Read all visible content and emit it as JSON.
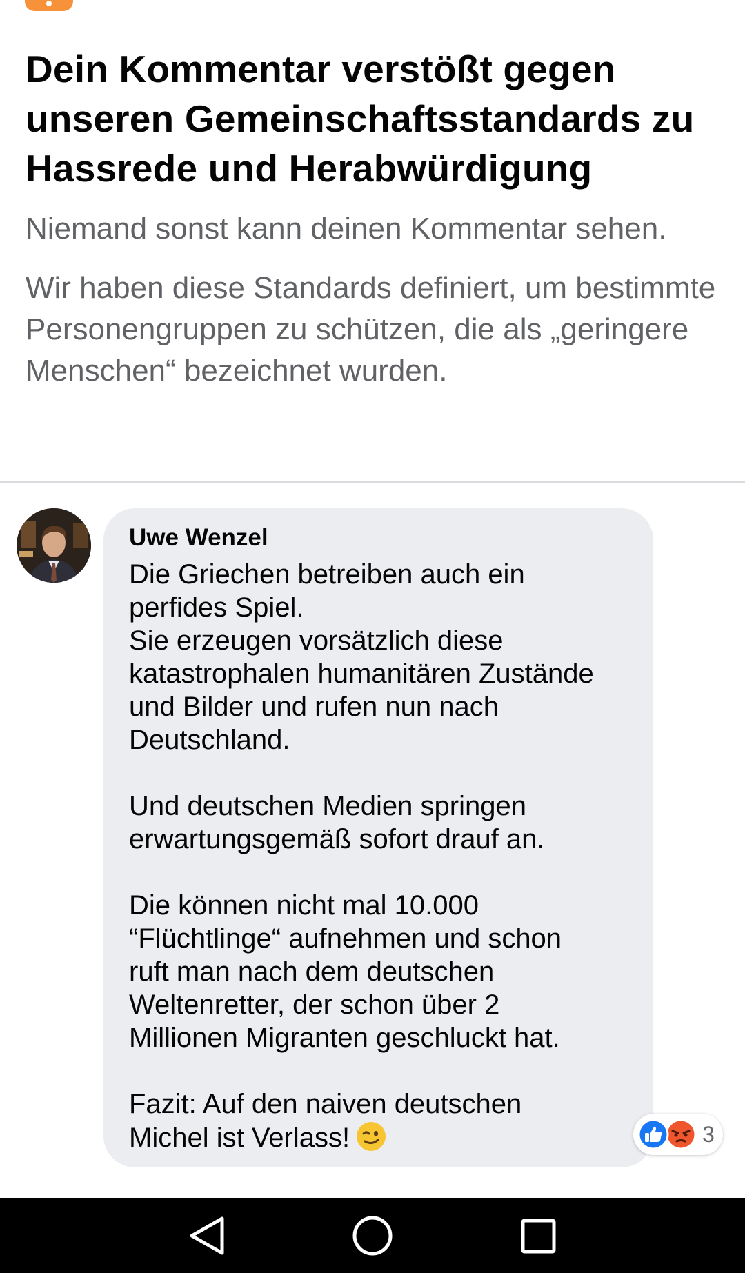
{
  "notice": {
    "title": "Dein Kommentar verstößt gegen unseren Gemeinschaftsstandards zu Hassrede und Herabwürdigung",
    "subtitle": "Niemand sonst kann deinen Kommentar sehen.",
    "body": "Wir haben diese Standards definiert, um bestimmte Personengruppen zu schützen, die als „geringere Menschen“ bezeichnet wurden.",
    "icon": "warning-icon",
    "accent_color": "#f7923a"
  },
  "comment": {
    "author": "Uwe Wenzel",
    "text": "Die Griechen betreiben auch ein\nperfides Spiel.\nSie erzeugen vorsätzlich diese\nkatastrophalen humanitären Zustände\nund Bilder und rufen nun nach\nDeutschland.\n\nUnd deutschen Medien springen\nerwartungsgemäß sofort drauf an.\n\nDie können nicht mal 10.000\n“Flüchtlinge“ aufnehmen und schon\nruft man nach dem deutschen\nWeltenretter, der schon über 2\nMillionen Migranten geschluckt hat.\n\nFazit: Auf den naiven deutschen\nMichel ist Verlass!",
    "trailing_emoji": "winking-face-emoji",
    "reactions": {
      "types": [
        "like",
        "angry"
      ],
      "count": "3"
    }
  },
  "navbar": {
    "buttons": [
      "back",
      "home",
      "recents"
    ]
  },
  "colors": {
    "bubble": "#ebedf0",
    "secondary_text": "#606266",
    "like_blue": "#1877f2",
    "angry_orange": "#f0562d"
  }
}
